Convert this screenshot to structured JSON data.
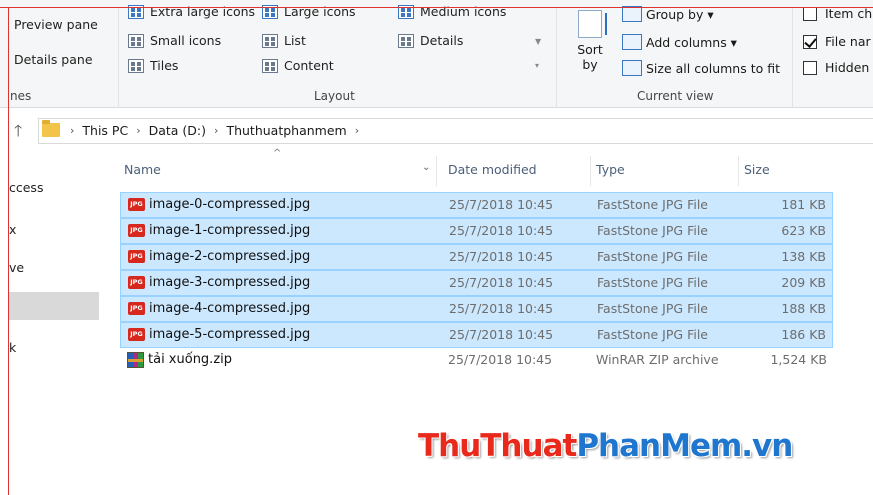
{
  "ribbon": {
    "panes": {
      "preview_pane": "Preview pane",
      "details_pane": "Details pane",
      "group_label": "nes"
    },
    "layout": {
      "extra_large": "Extra large icons",
      "large": "Large icons",
      "medium": "Medium icons",
      "small": "Small icons",
      "list": "List",
      "details": "Details",
      "tiles": "Tiles",
      "content": "Content",
      "group_label": "Layout"
    },
    "current_view": {
      "sort_line1": "Sort",
      "sort_line2": "by",
      "group_by": "Group by ▾",
      "add_columns": "Add columns ▾",
      "size_all": "Size all columns to fit",
      "group_label": "Current view"
    },
    "show_hide": {
      "item_check": "Item ch",
      "file_name_ext": "File nar",
      "hidden": "Hidden"
    }
  },
  "address": {
    "crumbs": [
      "This PC",
      "Data (D:)",
      "Thuthuatphanmem"
    ]
  },
  "nav": {
    "items": [
      "ccess",
      "x",
      "ve",
      "k"
    ]
  },
  "columns": {
    "name": "Name",
    "date": "Date modified",
    "type": "Type",
    "size": "Size"
  },
  "files": [
    {
      "icon": "jpg-icon",
      "icon_text": "JPG",
      "name": "image-0-compressed.jpg",
      "date": "25/7/2018 10:45",
      "type": "FastStone JPG File",
      "size": "181 KB",
      "selected": true
    },
    {
      "icon": "jpg-icon",
      "icon_text": "JPG",
      "name": "image-1-compressed.jpg",
      "date": "25/7/2018 10:45",
      "type": "FastStone JPG File",
      "size": "623 KB",
      "selected": true
    },
    {
      "icon": "jpg-icon",
      "icon_text": "JPG",
      "name": "image-2-compressed.jpg",
      "date": "25/7/2018 10:45",
      "type": "FastStone JPG File",
      "size": "138 KB",
      "selected": true
    },
    {
      "icon": "jpg-icon",
      "icon_text": "JPG",
      "name": "image-3-compressed.jpg",
      "date": "25/7/2018 10:45",
      "type": "FastStone JPG File",
      "size": "209 KB",
      "selected": true
    },
    {
      "icon": "jpg-icon",
      "icon_text": "JPG",
      "name": "image-4-compressed.jpg",
      "date": "25/7/2018 10:45",
      "type": "FastStone JPG File",
      "size": "188 KB",
      "selected": true
    },
    {
      "icon": "jpg-icon",
      "icon_text": "JPG",
      "name": "image-5-compressed.jpg",
      "date": "25/7/2018 10:45",
      "type": "FastStone JPG File",
      "size": "186 KB",
      "selected": true
    },
    {
      "icon": "zip-icon",
      "icon_text": "",
      "name": "tải xuống.zip",
      "date": "25/7/2018 10:45",
      "type": "WinRAR ZIP archive",
      "size": "1,524 KB",
      "selected": false
    }
  ],
  "watermark": {
    "part1": "ThuThuat",
    "part2": "PhanMem.vn"
  },
  "colors": {
    "selection_bg": "#cce8ff",
    "selection_border": "#99d1ff",
    "watermark_red": "#e8291b",
    "watermark_blue": "#1f76cf"
  }
}
